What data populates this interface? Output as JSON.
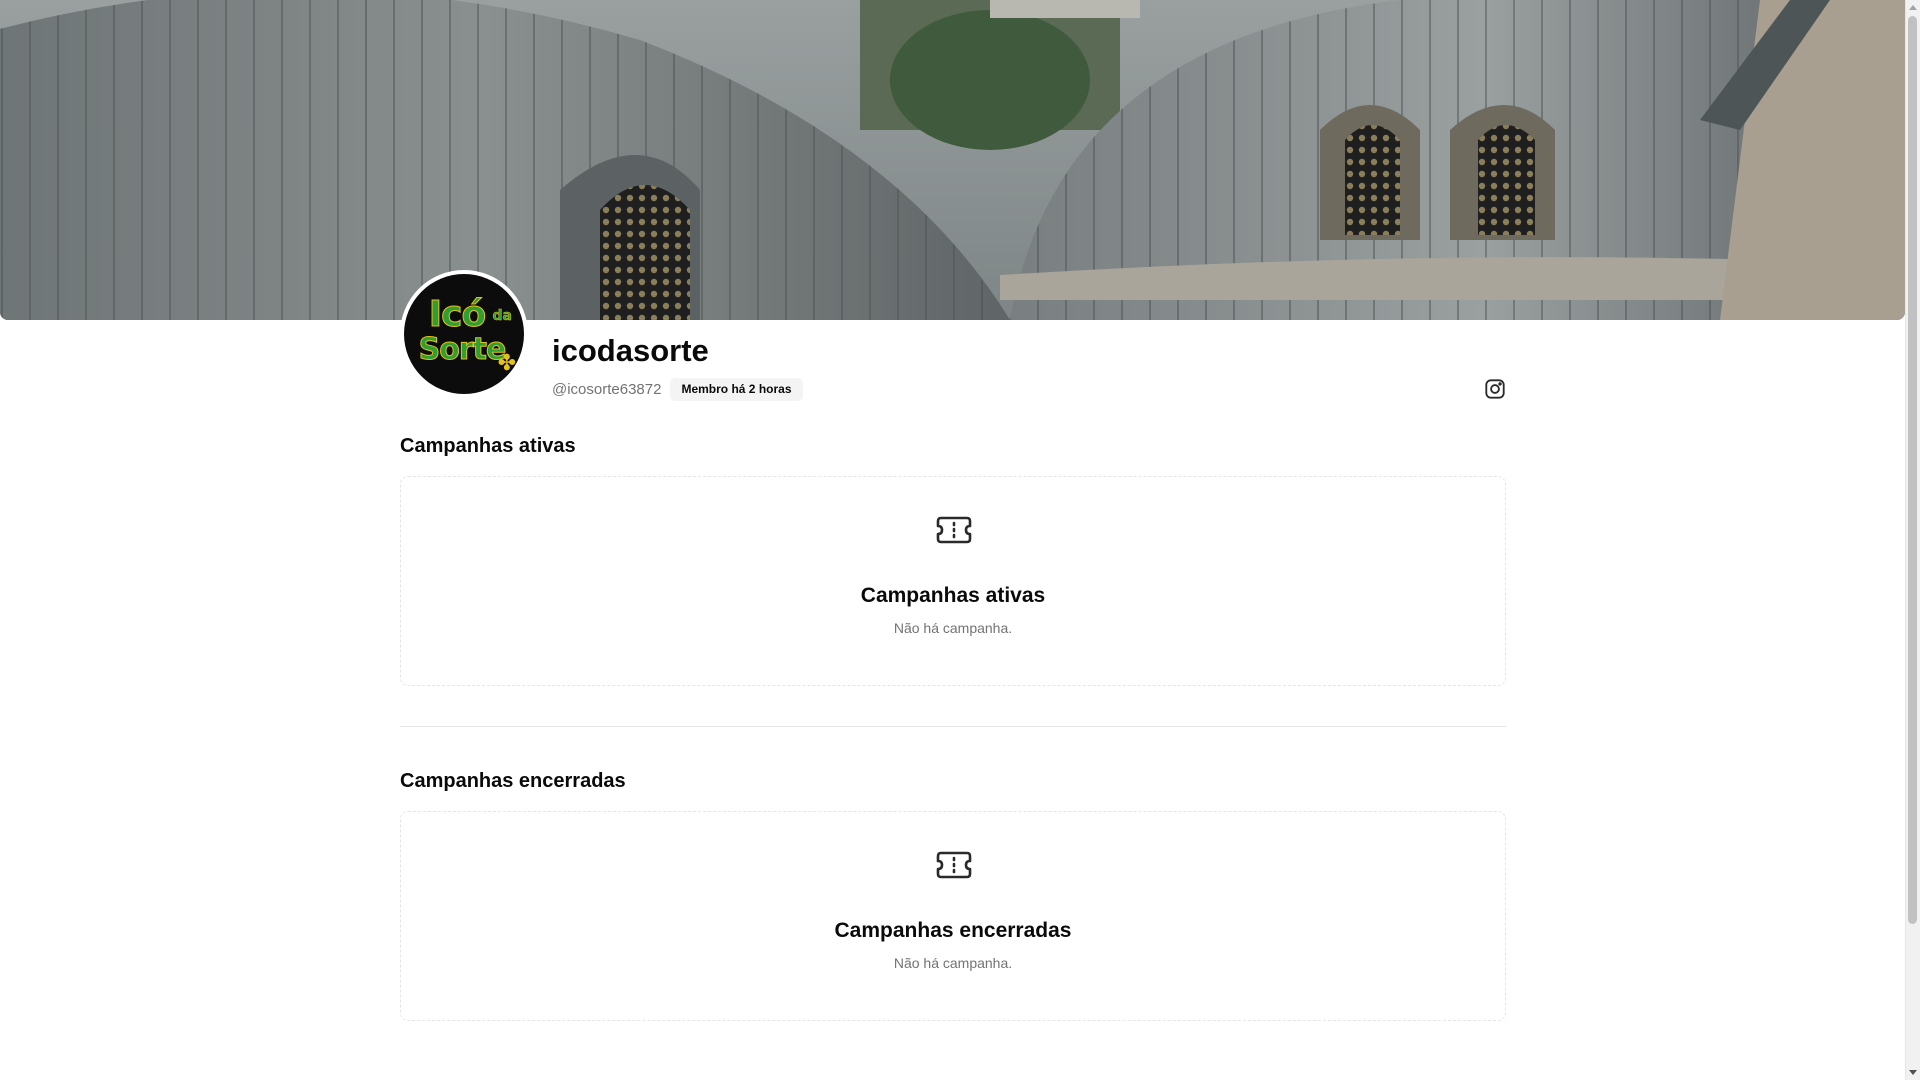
{
  "profile": {
    "name": "icodasorte",
    "handle": "@icosorte63872",
    "member_badge": "Membro há 2 horas",
    "avatar_logo": "Icó da Sorte"
  },
  "social": {
    "instagram_icon": "instagram-icon"
  },
  "sections": {
    "active": {
      "title": "Campanhas ativas",
      "empty_title": "Campanhas ativas",
      "empty_desc": "Não há campanha.",
      "icon": "ticket-icon"
    },
    "closed": {
      "title": "Campanhas encerradas",
      "empty_title": "Campanhas encerradas",
      "empty_desc": "Não há campanha.",
      "icon": "ticket-icon"
    }
  },
  "colors": {
    "text_primary": "#0a0a0a",
    "text_muted": "#737373",
    "badge_bg": "#f4f4f5",
    "border": "#e5e5e5",
    "logo_green": "#2f9e33",
    "logo_yellow": "#e3c21b"
  }
}
